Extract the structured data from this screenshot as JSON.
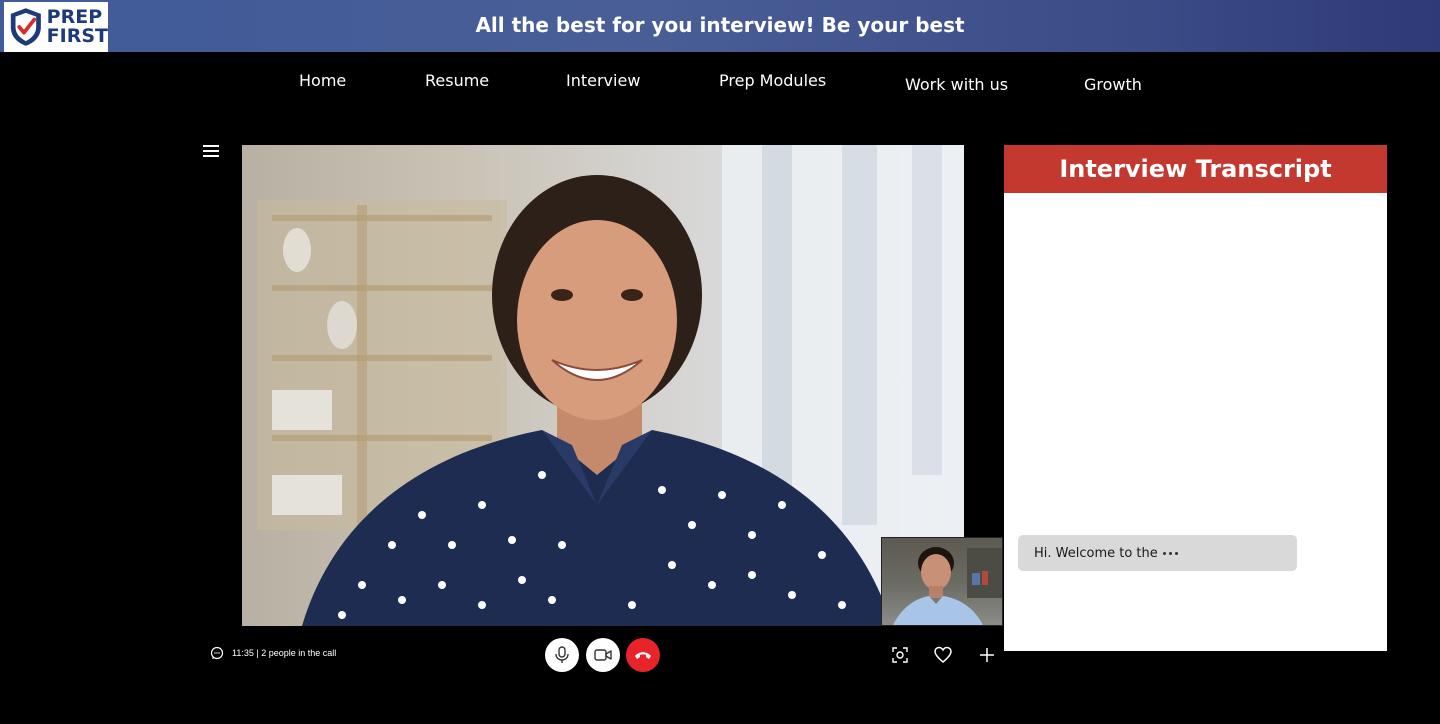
{
  "header": {
    "logo_line1": "PREP",
    "logo_line2": "FIRST",
    "banner_title": "All the best for you interview! Be your best"
  },
  "nav": {
    "items": [
      {
        "label": "Home"
      },
      {
        "label": "Resume"
      },
      {
        "label": "Interview"
      },
      {
        "label": "Prep Modules"
      },
      {
        "label": "Work with us"
      },
      {
        "label": "Growth"
      }
    ]
  },
  "call": {
    "status_text": "11:35 | 2 people in the call",
    "controls": {
      "mic": "microphone-icon",
      "camera": "video-camera-icon",
      "end_call": "end-call-icon"
    },
    "tools": [
      "screenshot-icon",
      "heart-icon",
      "plus-icon"
    ]
  },
  "transcript": {
    "title": "Interview Transcript",
    "messages": [
      {
        "text": "Hi. Welcome to the",
        "typing": true
      }
    ]
  },
  "colors": {
    "banner_start": "#3f5b9a",
    "banner_end": "#2f3a78",
    "transcript_header": "#c4392f",
    "end_call": "#e8242b",
    "logo_blue": "#1f3a78",
    "logo_red": "#d62b2b"
  }
}
